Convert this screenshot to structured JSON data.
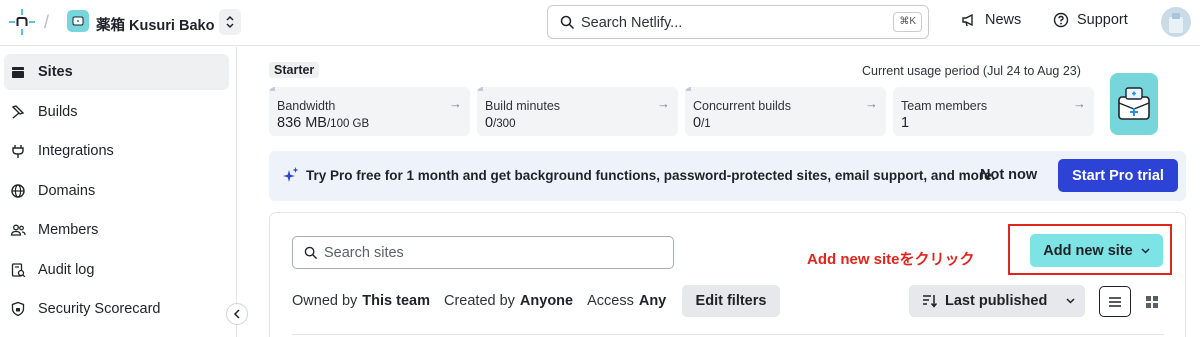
{
  "topbar": {
    "team_name": "薬箱 Kusuri Bako",
    "search_placeholder": "Search Netlify...",
    "search_shortcut": "⌘K",
    "news_label": "News",
    "support_label": "Support"
  },
  "sidebar": {
    "items": [
      {
        "label": "Sites",
        "icon": "sites-icon",
        "active": true
      },
      {
        "label": "Builds",
        "icon": "builds-icon"
      },
      {
        "label": "Integrations",
        "icon": "integrations-icon"
      },
      {
        "label": "Domains",
        "icon": "globe-icon"
      },
      {
        "label": "Members",
        "icon": "members-icon"
      },
      {
        "label": "Audit log",
        "icon": "audit-log-icon"
      },
      {
        "label": "Security Scorecard",
        "icon": "shield-icon"
      }
    ]
  },
  "usage": {
    "plan": "Starter",
    "period": "Current usage period (Jul 24 to Aug 23)",
    "cards": [
      {
        "label": "Bandwidth",
        "value": "836 MB",
        "limit": "/100 GB",
        "fill": 0.0082
      },
      {
        "label": "Build minutes",
        "value": "0",
        "limit": "/300",
        "fill": 0
      },
      {
        "label": "Concurrent builds",
        "value": "0",
        "limit": "/1",
        "fill": 0
      },
      {
        "label": "Team members",
        "value": "1",
        "limit": "",
        "fill": 0
      }
    ]
  },
  "promo": {
    "text": "Try Pro free for 1 month and get background functions, password-protected sites, email support, and more.",
    "dismiss_label": "Not now",
    "cta_label": "Start Pro trial"
  },
  "sites": {
    "search_placeholder": "Search sites",
    "annotation": "Add new siteをクリック",
    "add_button_label": "Add new site",
    "filters": [
      {
        "label": "Owned by",
        "value": "This team"
      },
      {
        "label": "Created by",
        "value": "Anyone"
      },
      {
        "label": "Access",
        "value": "Any"
      }
    ],
    "edit_filters_label": "Edit filters",
    "sort_label": "Last published"
  },
  "colors": {
    "accent": "#2d43d5",
    "teal": "#7de3e4",
    "annotation_red": "#e0251f"
  }
}
